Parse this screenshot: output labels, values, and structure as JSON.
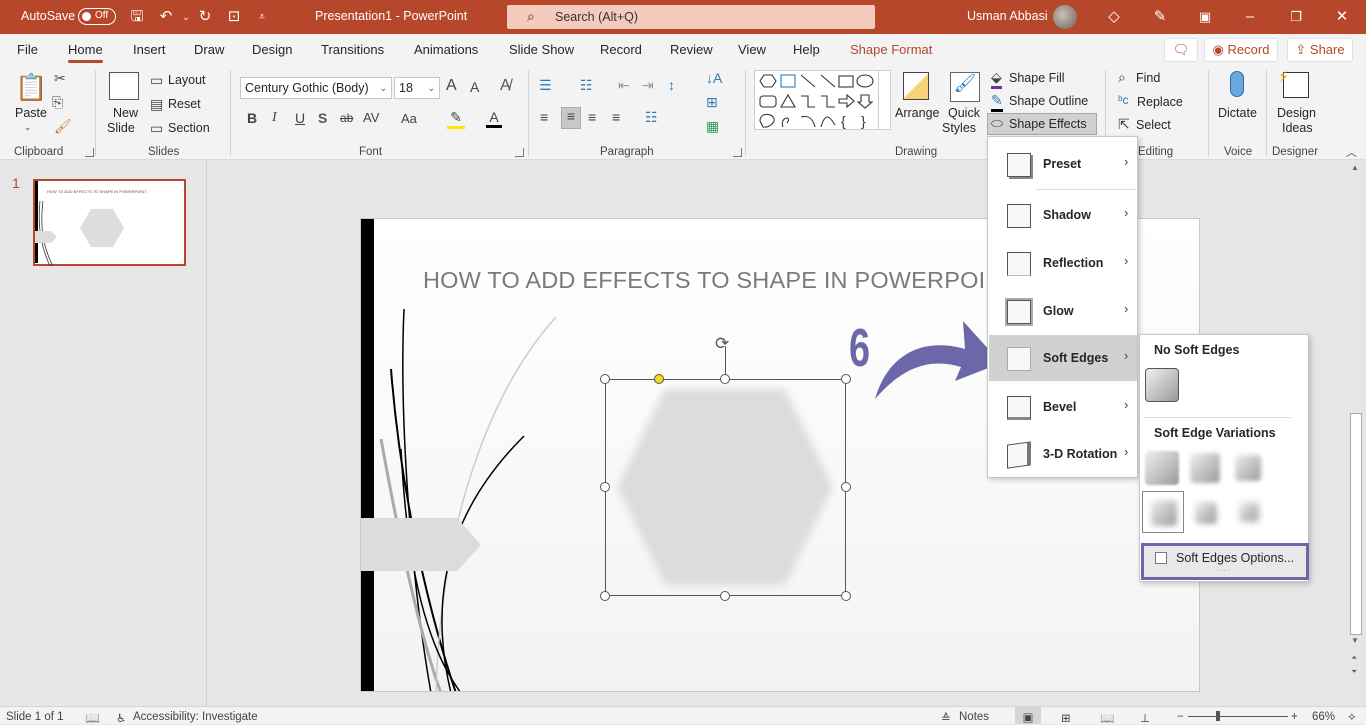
{
  "titlebar": {
    "autosave_label": "AutoSave",
    "autosave_state": "Off",
    "document_title": "Presentation1  -  PowerPoint",
    "search_placeholder": "Search (Alt+Q)",
    "user_name": "Usman Abbasi",
    "quick_access_icons": [
      "save-icon",
      "undo-icon",
      "redo-icon",
      "present-icon",
      "customize-icon"
    ],
    "window_controls": [
      "ribbon-display-icon",
      "minimize-icon",
      "restore-icon",
      "close-icon"
    ]
  },
  "tabs": [
    {
      "label": "File"
    },
    {
      "label": "Home",
      "active": true
    },
    {
      "label": "Insert"
    },
    {
      "label": "Draw"
    },
    {
      "label": "Design"
    },
    {
      "label": "Transitions"
    },
    {
      "label": "Animations"
    },
    {
      "label": "Slide Show"
    },
    {
      "label": "Record"
    },
    {
      "label": "Review"
    },
    {
      "label": "View"
    },
    {
      "label": "Help"
    },
    {
      "label": "Shape Format",
      "contextual": true
    }
  ],
  "top_buttons": {
    "record": "Record",
    "share": "Share"
  },
  "ribbon": {
    "clipboard": {
      "group": "Clipboard",
      "paste": "Paste"
    },
    "slides": {
      "group": "Slides",
      "new_slide_1": "New",
      "new_slide_2": "Slide",
      "layout": "Layout",
      "reset": "Reset",
      "section": "Section"
    },
    "font": {
      "group": "Font",
      "font_name": "Century Gothic (Body)",
      "font_size": "18",
      "bold": "B",
      "italic": "I",
      "underline": "U",
      "shadow": "S",
      "strike": "ab",
      "spacing": "AV",
      "case": "Aa",
      "grow": "A",
      "shrink": "A",
      "color": "A"
    },
    "paragraph": {
      "group": "Paragraph"
    },
    "drawing": {
      "group": "Drawing",
      "arrange": "Arrange",
      "quick_styles_1": "Quick",
      "quick_styles_2": "Styles",
      "shape_fill": "Shape Fill",
      "shape_outline": "Shape Outline",
      "shape_effects": "Shape Effects"
    },
    "editing": {
      "group": "Editing",
      "find": "Find",
      "replace": "Replace",
      "select": "Select"
    },
    "voice": {
      "group": "Voice",
      "dictate": "Dictate"
    },
    "designer": {
      "group": "Designer",
      "design_ideas_1": "Design",
      "design_ideas_2": "Ideas"
    }
  },
  "slide_panel": {
    "slide_number": "1"
  },
  "slide": {
    "title": "HOW TO ADD EFFECTS TO SHAPE IN POWERPOINT",
    "annotation_step": "6",
    "annotation_color": "#6b67a8"
  },
  "effects_menu": {
    "items": [
      {
        "label": "Preset",
        "key": "P"
      },
      {
        "label": "Shadow",
        "key": "S"
      },
      {
        "label": "Reflection",
        "key": "R"
      },
      {
        "label": "Glow",
        "key": "G"
      },
      {
        "label": "Soft Edges",
        "key": "E",
        "highlighted": true
      },
      {
        "label": "Bevel",
        "key": "B"
      },
      {
        "label": "3-D Rotation",
        "key": "D"
      }
    ]
  },
  "soft_edges_submenu": {
    "no_soft_edges": "No Soft Edges",
    "variations": "Soft Edge Variations",
    "variation_count": 6,
    "selected_variation": 4,
    "options": "Soft Edges Options..."
  },
  "status": {
    "slide_info": "Slide 1 of 1",
    "accessibility": "Accessibility: Investigate",
    "notes": "Notes",
    "zoom": "66%"
  },
  "colors": {
    "accent": "#b7472a",
    "annotation": "#6b67a8"
  }
}
